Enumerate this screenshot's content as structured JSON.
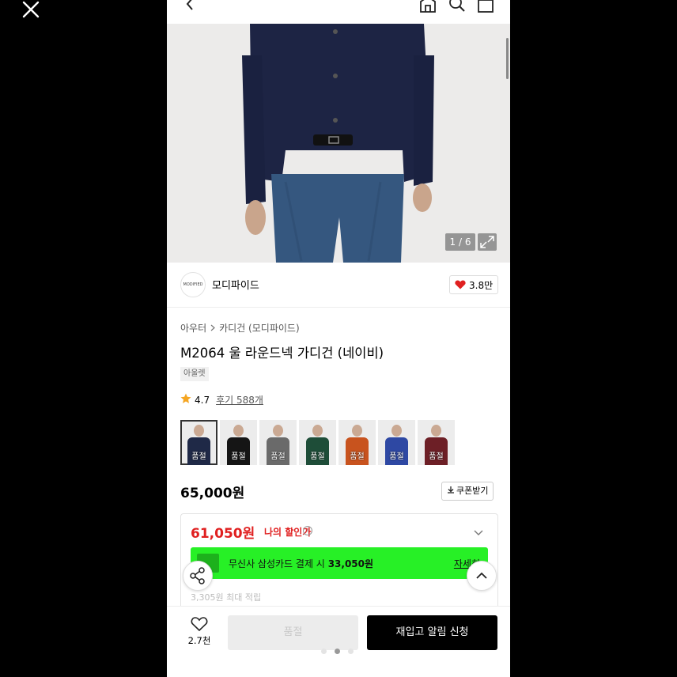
{
  "brand": {
    "logo_text": "MODIFIED",
    "name": "모디파이드",
    "likes": "3.8만"
  },
  "gallery": {
    "counter": "1 / 6"
  },
  "breadcrumb": {
    "level1": "아우터",
    "level2": "카디건 (모디파이드)"
  },
  "product": {
    "title": "M2064 울 라운드넥 가디건 (네이비)",
    "tag": "아울렛",
    "rating": "4.7",
    "reviews": "후기 588개",
    "price": "65,000원",
    "coupon_label": "쿠폰받기"
  },
  "swatches": [
    {
      "color": "#1f2947",
      "label": "품절"
    },
    {
      "color": "#151515",
      "label": "품절"
    },
    {
      "color": "#6a6a6a",
      "label": "품절"
    },
    {
      "color": "#1e4d38",
      "label": "품절"
    },
    {
      "color": "#c8531e",
      "label": "품절"
    },
    {
      "color": "#2e48a3",
      "label": "품절"
    },
    {
      "color": "#6d1f26",
      "label": "품절"
    }
  ],
  "discount": {
    "price": "61,050원",
    "label": "나의 할인가",
    "info": "i",
    "card_prefix": "무신사 삼성카드 결제 시",
    "card_price": "33,050원",
    "card_more": "자세히",
    "faded_text": "3,305원 최대 적립"
  },
  "bottom": {
    "wish_count": "2.7천",
    "soldout_label": "품절",
    "restock_label": "재입고 알림 신청"
  },
  "colors": {
    "accent_red": "#e02020",
    "promo_green": "#27f026"
  }
}
